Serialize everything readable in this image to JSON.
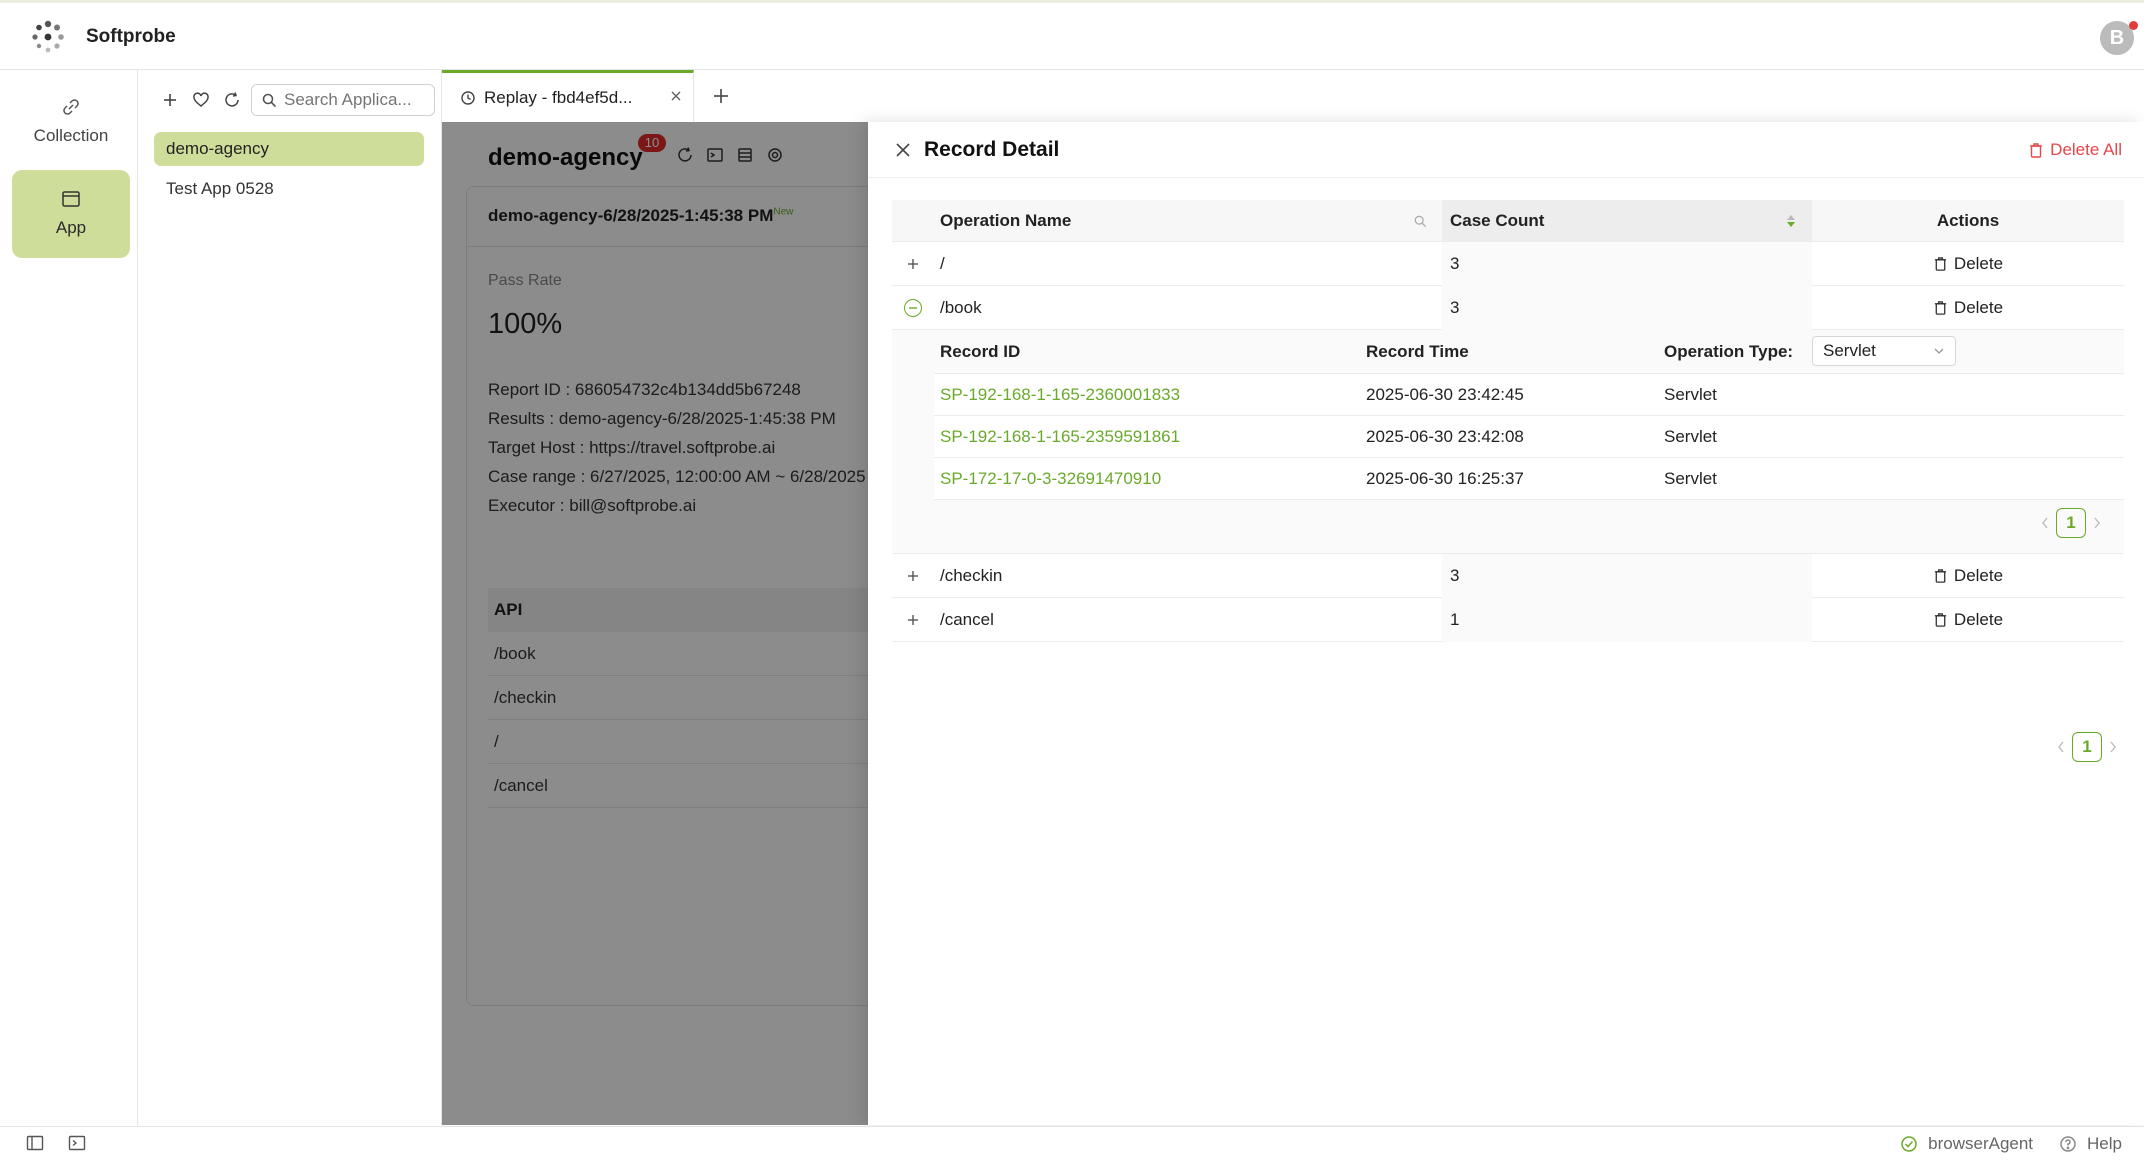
{
  "app": {
    "brand": "Softprobe",
    "avatar_letter": "B"
  },
  "nav": {
    "items": [
      {
        "label": "Collection",
        "icon": "link-icon"
      },
      {
        "label": "App",
        "icon": "window-icon"
      }
    ]
  },
  "applist": {
    "search_placeholder": "Search Applica...",
    "items": [
      "demo-agency",
      "Test App 0528"
    ]
  },
  "tabs": {
    "items": [
      {
        "label": "Replay - fbd4ef5d...",
        "icon": "history-icon"
      }
    ]
  },
  "report": {
    "title": "demo-agency",
    "badge": "10",
    "subtitle": "demo-agency-6/28/2025-1:45:38 PM",
    "subtitle_tag": "New",
    "pass_rate_label": "Pass Rate",
    "pass_rate": "100%",
    "info": [
      "Report ID : 686054732c4b134dd5b67248",
      "Results : demo-agency-6/28/2025-1:45:38 PM",
      "Target Host : https://travel.softprobe.ai",
      "Case range : 6/27/2025, 12:00:00 AM ~ 6/28/2025",
      "Executor : bill@softprobe.ai"
    ],
    "api_header": "API",
    "apis": [
      "/book",
      "/checkin",
      "/",
      "/cancel"
    ]
  },
  "drawer": {
    "title": "Record Detail",
    "delete_all": "Delete All",
    "columns": {
      "name": "Operation Name",
      "count": "Case Count",
      "actions": "Actions"
    },
    "delete_label": "Delete",
    "operations": [
      {
        "name": "/",
        "count": "3"
      },
      {
        "name": "/book",
        "count": "3"
      },
      {
        "name": "/checkin",
        "count": "3"
      },
      {
        "name": "/cancel",
        "count": "1"
      }
    ],
    "sub": {
      "columns": {
        "id": "Record ID",
        "time": "Record Time",
        "type": "Operation Type:"
      },
      "type_filter": "Servlet",
      "records": [
        {
          "id": "SP-192-168-1-165-2360001833",
          "time": "2025-06-30 23:42:45",
          "type": "Servlet"
        },
        {
          "id": "SP-192-168-1-165-2359591861",
          "time": "2025-06-30 23:42:08",
          "type": "Servlet"
        },
        {
          "id": "SP-172-17-0-3-32691470910",
          "time": "2025-06-30 16:25:37",
          "type": "Servlet"
        }
      ],
      "page": "1"
    },
    "page": "1"
  },
  "footer": {
    "agent": "browserAgent",
    "help": "Help"
  },
  "colors": {
    "accent": "#6aaa2a",
    "active_bg": "#cfdd9b",
    "danger": "#e5474b"
  }
}
